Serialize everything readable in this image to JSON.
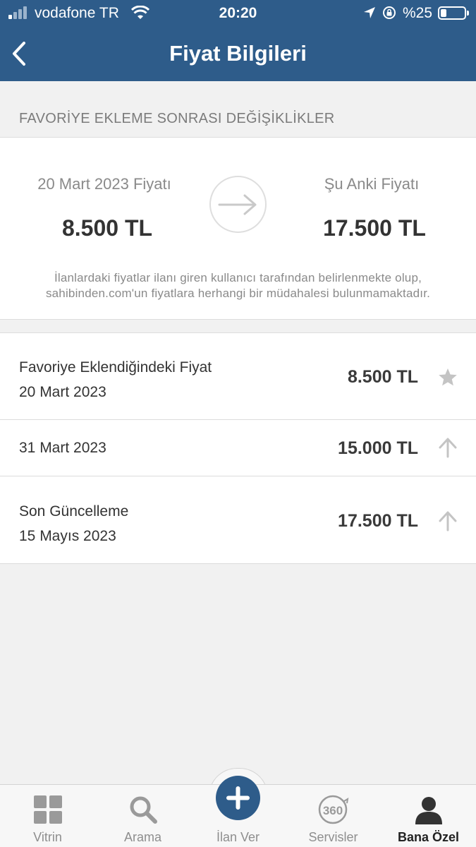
{
  "status_bar": {
    "carrier": "vodafone TR",
    "time": "20:20",
    "battery_percent": "%25",
    "battery_level": 0.25
  },
  "nav": {
    "title": "Fiyat Bilgileri",
    "back_icon": "chevron-left-icon"
  },
  "section_header": "FAVORİYE EKLEME SONRASI DEĞİŞİKLİKLER",
  "comparison": {
    "old_label": "20 Mart 2023 Fiyatı",
    "old_price": "8.500 TL",
    "new_label": "Şu Anki Fiyatı",
    "new_price": "17.500 TL",
    "arrow_icon": "arrow-right-icon",
    "disclaimer_line1": "İlanlardaki fiyatlar ilanı giren kullanıcı tarafından belirlenmekte olup,",
    "disclaimer_line2": "sahibinden.com'un fiyatlara herhangi bir müdahalesi bulunmamaktadır."
  },
  "history": [
    {
      "title": "Favoriye Eklendiğindeki Fiyat",
      "date": "20 Mart 2023",
      "price": "8.500 TL",
      "icon": "star-icon"
    },
    {
      "title": "",
      "date": "31 Mart 2023",
      "price": "15.000 TL",
      "icon": "arrow-up-icon"
    },
    {
      "title": "Son Güncelleme",
      "date": "15 Mayıs 2023",
      "price": "17.500 TL",
      "icon": "arrow-up-icon"
    }
  ],
  "tabbar": {
    "tabs": [
      {
        "label": "Vitrin",
        "icon": "grid-icon"
      },
      {
        "label": "Arama",
        "icon": "search-icon"
      },
      {
        "label": "İlan Ver",
        "icon": "plus-icon"
      },
      {
        "label": "Servisler",
        "icon": "360-icon"
      },
      {
        "label": "Bana Özel",
        "icon": "user-icon"
      }
    ],
    "active": "Bana Özel"
  },
  "colors": {
    "brand": "#2e5c8a",
    "background": "#f1f1f1",
    "icon_gray": "#c4c4c4"
  }
}
